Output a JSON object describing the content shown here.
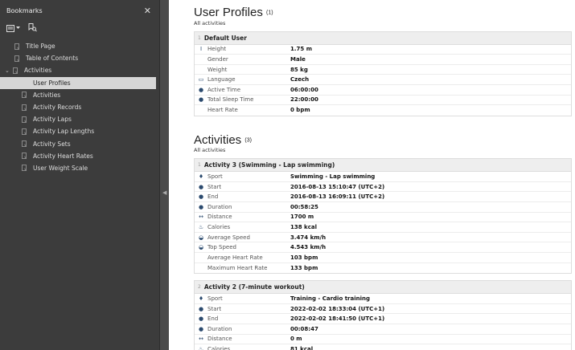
{
  "sidebar": {
    "title": "Bookmarks",
    "close": "✕",
    "items": [
      {
        "label": "Title Page",
        "level": 0
      },
      {
        "label": "Table of Contents",
        "level": 0
      },
      {
        "label": "Activities",
        "level": 0,
        "expanded": true
      },
      {
        "label": "User Profiles",
        "level": 1,
        "selected": true
      },
      {
        "label": "Activities",
        "level": 1
      },
      {
        "label": "Activity Records",
        "level": 1
      },
      {
        "label": "Activity Laps",
        "level": 1
      },
      {
        "label": "Activity Lap Lengths",
        "level": 1
      },
      {
        "label": "Activity Sets",
        "level": 1
      },
      {
        "label": "Activity Heart Rates",
        "level": 1
      },
      {
        "label": "User Weight Scale",
        "level": 1
      }
    ]
  },
  "profiles": {
    "title": "User Profiles",
    "count": "(1)",
    "subtitle": "All activities",
    "table": {
      "num": "1",
      "header": "Default User",
      "rows": [
        {
          "icon": "height-icon",
          "label": "Height",
          "value": "1.75 m"
        },
        {
          "icon": "",
          "label": "Gender",
          "value": "Male"
        },
        {
          "icon": "",
          "label": "Weight",
          "value": "85 kg"
        },
        {
          "icon": "language-icon",
          "label": "Language",
          "value": "Czech"
        },
        {
          "icon": "clock-icon",
          "label": "Active Time",
          "value": "06:00:00"
        },
        {
          "icon": "clock-icon",
          "label": "Total Sleep Time",
          "value": "22:00:00"
        },
        {
          "icon": "",
          "label": "Heart Rate",
          "value": "0 bpm"
        }
      ]
    }
  },
  "activities": {
    "title": "Activities",
    "count": "(3)",
    "subtitle": "All activities",
    "tables": [
      {
        "num": "1",
        "header": "Activity 3 (Swimming - Lap swimming)",
        "rows": [
          {
            "icon": "trophy-icon",
            "label": "Sport",
            "value": "Swimming - Lap swimming"
          },
          {
            "icon": "clock-icon",
            "label": "Start",
            "value": "2016-08-13 15:10:47 (UTC+2)"
          },
          {
            "icon": "clock-icon",
            "label": "End",
            "value": "2016-08-13 16:09:11 (UTC+2)"
          },
          {
            "icon": "clock-icon",
            "label": "Duration",
            "value": "00:58:25"
          },
          {
            "icon": "distance-icon",
            "label": "Distance",
            "value": "1700 m"
          },
          {
            "icon": "flame-icon",
            "label": "Calories",
            "value": "138 kcal"
          },
          {
            "icon": "speedometer-icon",
            "label": "Average Speed",
            "value": "3.474 km/h"
          },
          {
            "icon": "speedometer-icon",
            "label": "Top Speed",
            "value": "4.543 km/h"
          },
          {
            "icon": "",
            "label": "Average Heart Rate",
            "value": "103 bpm"
          },
          {
            "icon": "",
            "label": "Maximum Heart Rate",
            "value": "133 bpm"
          }
        ]
      },
      {
        "num": "2",
        "header": "Activity 2 (7-minute workout)",
        "rows": [
          {
            "icon": "trophy-icon",
            "label": "Sport",
            "value": "Training - Cardio training"
          },
          {
            "icon": "clock-icon",
            "label": "Start",
            "value": "2022-02-02 18:33:04 (UTC+1)"
          },
          {
            "icon": "clock-icon",
            "label": "End",
            "value": "2022-02-02 18:41:50 (UTC+1)"
          },
          {
            "icon": "clock-icon",
            "label": "Duration",
            "value": "00:08:47"
          },
          {
            "icon": "distance-icon",
            "label": "Distance",
            "value": "0 m"
          },
          {
            "icon": "flame-icon",
            "label": "Calories",
            "value": "81 kcal"
          }
        ]
      }
    ]
  }
}
